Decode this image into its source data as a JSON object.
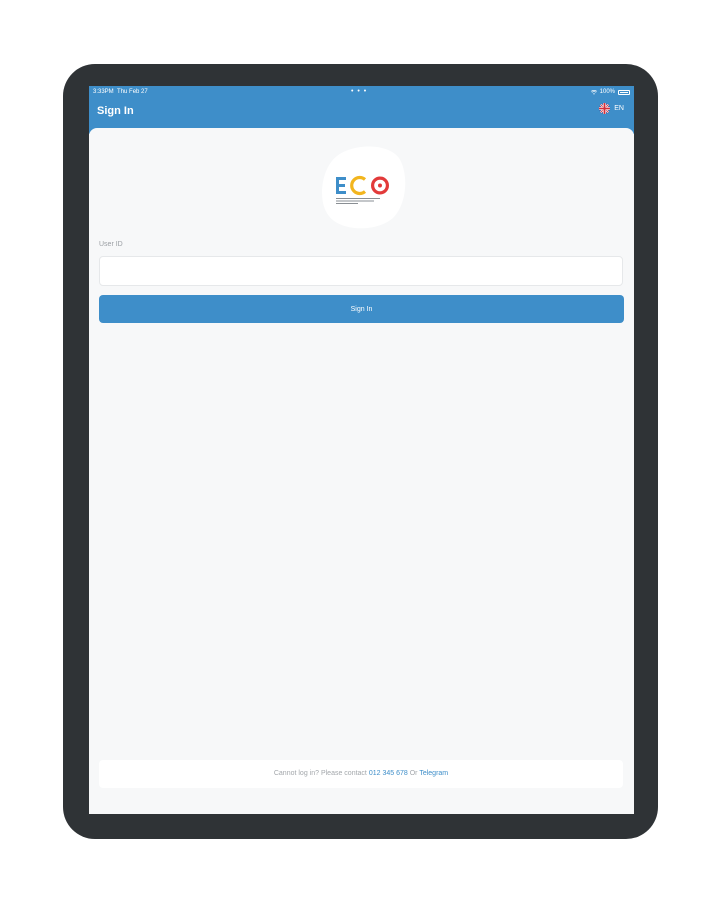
{
  "status_bar": {
    "time": "3:33PM",
    "date": "Thu Feb 27",
    "dots": "• • •",
    "battery": "100%"
  },
  "nav": {
    "title": "Sign In",
    "language": "EN"
  },
  "form": {
    "user_id_label": "User ID",
    "user_id_value": "",
    "user_id_placeholder": "",
    "submit_label": "Sign In"
  },
  "footer": {
    "prefix": "Cannot log in? Please contact",
    "phone": "012 345 678",
    "separator": "Or",
    "telegram": "Telegram"
  },
  "colors": {
    "primary": "#3e8ec9",
    "background": "#f7f8f9",
    "device_frame": "#2f3336"
  },
  "icons": {
    "flag": "uk-flag-icon",
    "wifi": "wifi-icon",
    "battery": "battery-icon",
    "logo": "eco-logo"
  }
}
